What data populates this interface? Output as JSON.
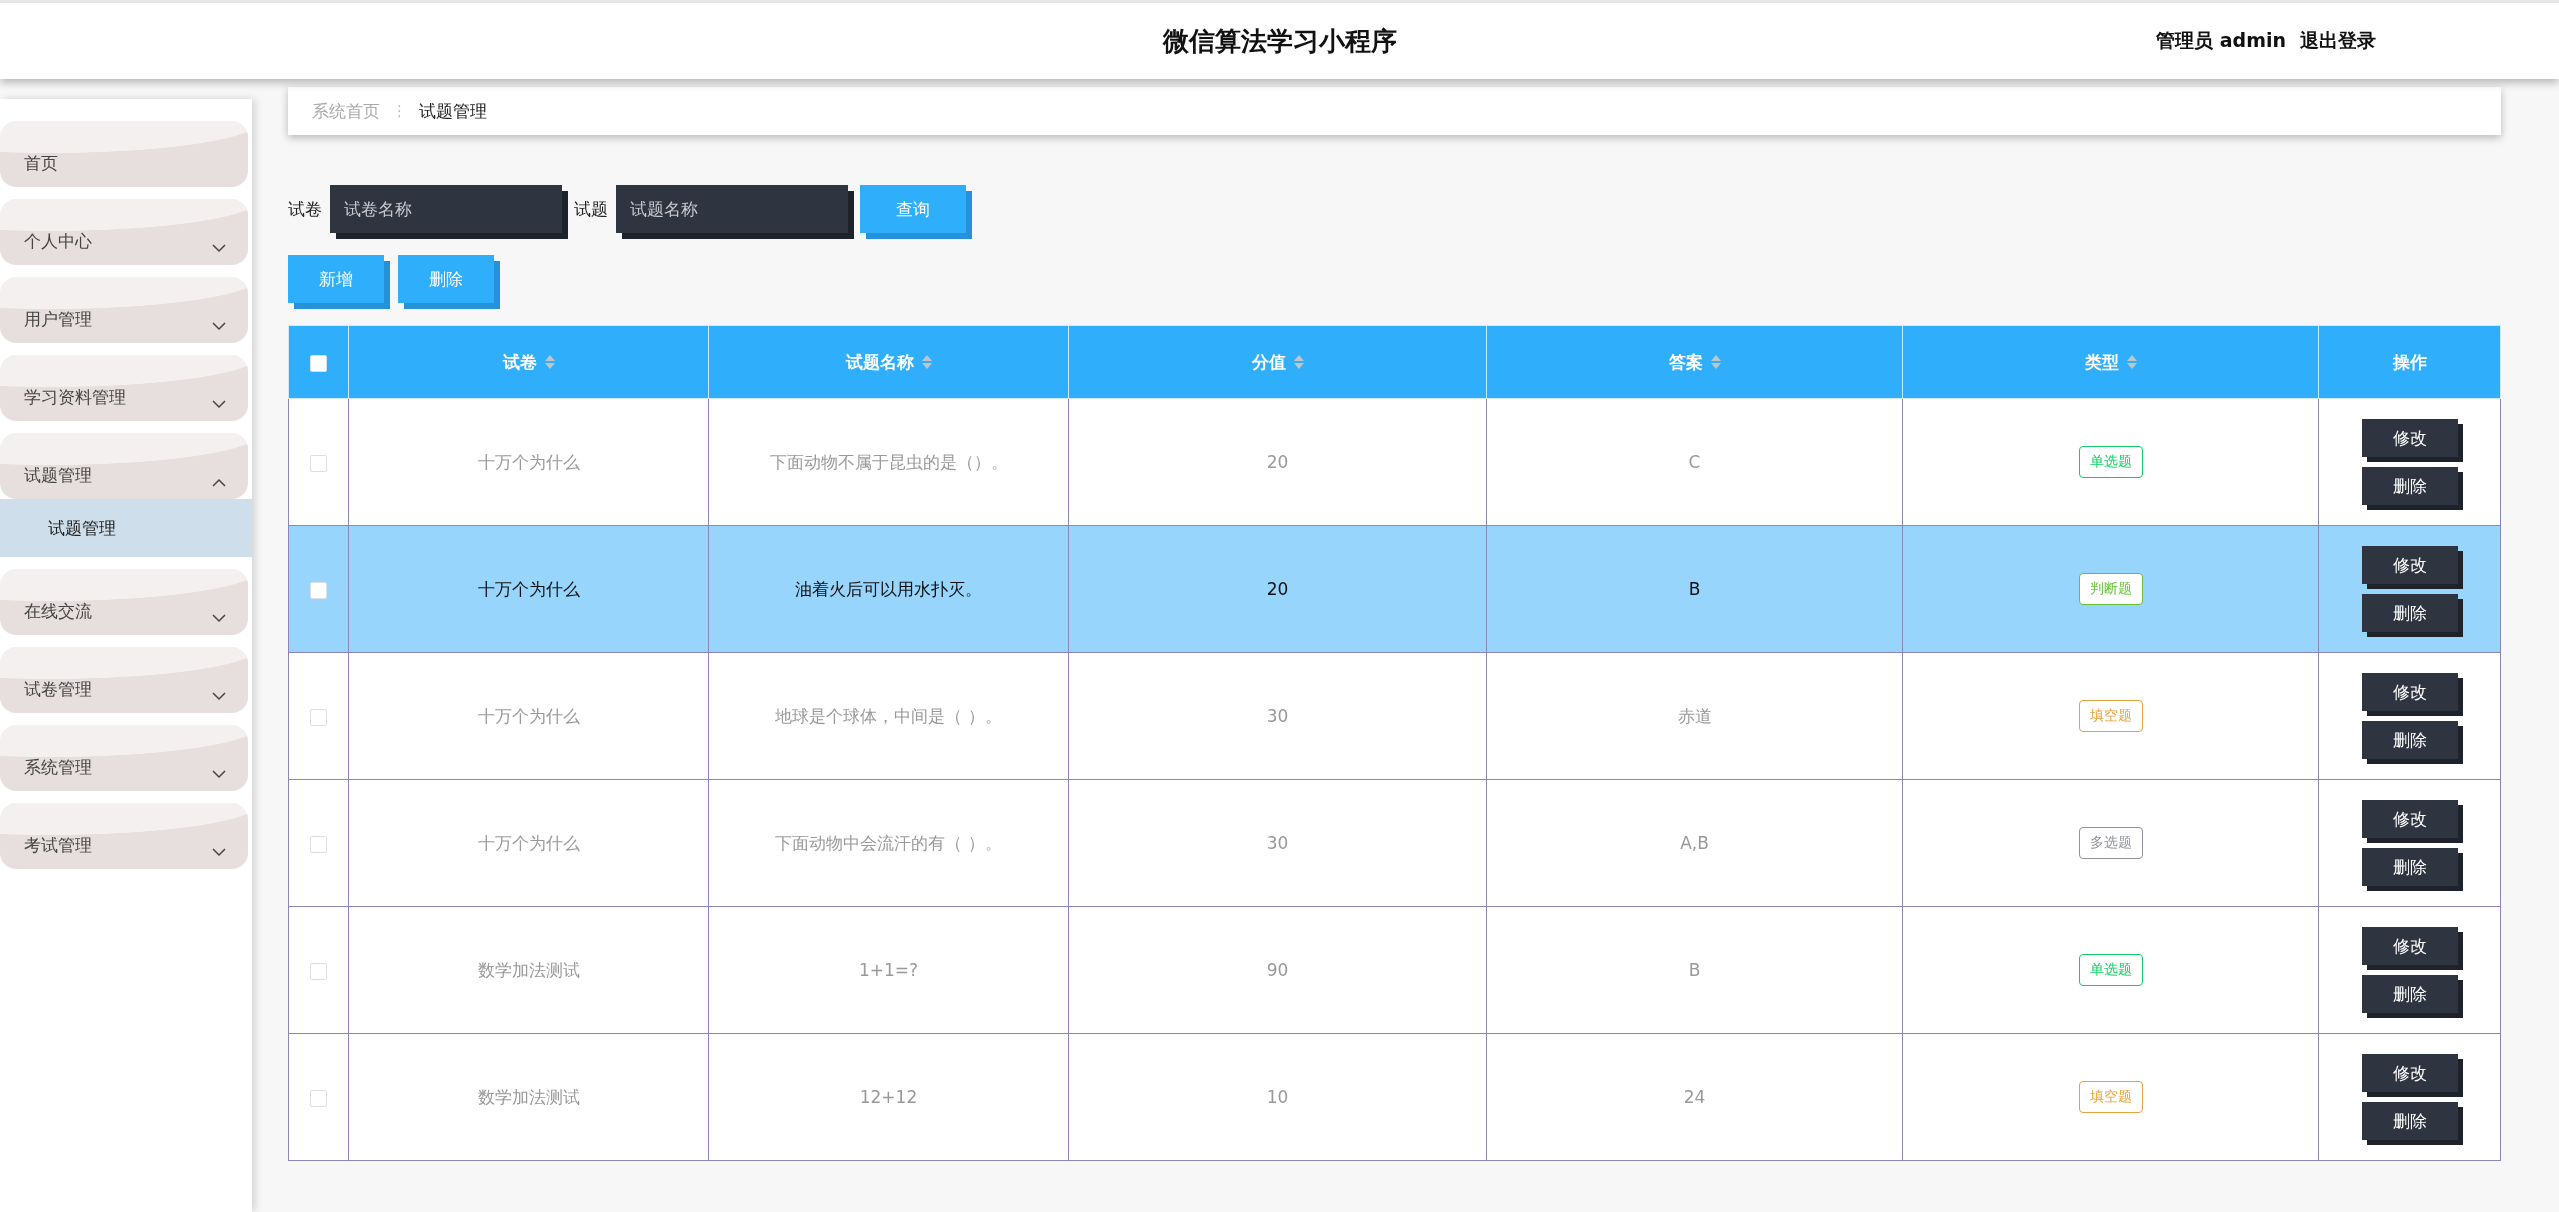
{
  "header": {
    "title": "微信算法学习小程序",
    "user_label": "管理员 admin",
    "logout": "退出登录"
  },
  "sidebar": {
    "items": [
      {
        "label": "首页",
        "kind": "link"
      },
      {
        "label": "个人中心",
        "kind": "menu",
        "expanded": false
      },
      {
        "label": "用户管理",
        "kind": "menu",
        "expanded": false
      },
      {
        "label": "学习资料管理",
        "kind": "menu",
        "expanded": false
      },
      {
        "label": "试题管理",
        "kind": "menu",
        "expanded": true,
        "children": [
          {
            "label": "试题管理",
            "selected": true
          }
        ]
      },
      {
        "label": "在线交流",
        "kind": "menu",
        "expanded": false
      },
      {
        "label": "试卷管理",
        "kind": "menu",
        "expanded": false
      },
      {
        "label": "系统管理",
        "kind": "menu",
        "expanded": false
      },
      {
        "label": "考试管理",
        "kind": "menu",
        "expanded": false
      }
    ]
  },
  "breadcrumb": [
    {
      "label": "系统首页",
      "selected": false
    },
    {
      "label": "试题管理",
      "selected": true
    }
  ],
  "breadcrumb_separator": "⋮",
  "search": {
    "fields": [
      {
        "label": "试卷",
        "placeholder": "试卷名称"
      },
      {
        "label": "试题",
        "placeholder": "试题名称"
      }
    ],
    "button": "查询"
  },
  "actions": [
    "新增",
    "删除"
  ],
  "table": {
    "columns": [
      {
        "label": "试卷",
        "sortable": true
      },
      {
        "label": "试题名称",
        "sortable": true
      },
      {
        "label": "分值",
        "sortable": true
      },
      {
        "label": "答案",
        "sortable": true
      },
      {
        "label": "类型",
        "sortable": true
      },
      {
        "label": "操作",
        "sortable": false
      }
    ],
    "header_checked": false,
    "rows": [
      {
        "paper": "十万个为什么",
        "question": "下面动物不属于昆虫的是（）。",
        "score": "20",
        "answer": "C",
        "type": {
          "label": "单选题",
          "color": "#13ce66"
        },
        "selected": false,
        "checked": false,
        "buttons": [
          "修改",
          "删除"
        ]
      },
      {
        "paper": "十万个为什么",
        "question": "油着火后可以用水扑灭。",
        "score": "20",
        "answer": "B",
        "type": {
          "label": "判断题",
          "color": "#67c23a"
        },
        "selected": true,
        "checked": false,
        "buttons": [
          "修改",
          "删除"
        ]
      },
      {
        "paper": "十万个为什么",
        "question": "地球是个球体，中间是（ ）。",
        "score": "30",
        "answer": "赤道",
        "type": {
          "label": "填空题",
          "color": "#e6a23c"
        },
        "selected": false,
        "checked": false,
        "buttons": [
          "修改",
          "删除"
        ]
      },
      {
        "paper": "十万个为什么",
        "question": "下面动物中会流汗的有（ ）。",
        "score": "30",
        "answer": "A,B",
        "type": {
          "label": "多选题",
          "color": "#909399"
        },
        "selected": false,
        "checked": false,
        "buttons": [
          "修改",
          "删除"
        ]
      },
      {
        "paper": "数学加法测试",
        "question": "1+1=?",
        "score": "90",
        "answer": "B",
        "type": {
          "label": "单选题",
          "color": "#13ce66"
        },
        "selected": false,
        "checked": false,
        "buttons": [
          "修改",
          "删除"
        ]
      },
      {
        "paper": "数学加法测试",
        "question": "12+12",
        "score": "10",
        "answer": "24",
        "type": {
          "label": "填空题",
          "color": "#e6a23c"
        },
        "selected": false,
        "checked": false,
        "buttons": [
          "修改",
          "删除"
        ]
      }
    ]
  }
}
